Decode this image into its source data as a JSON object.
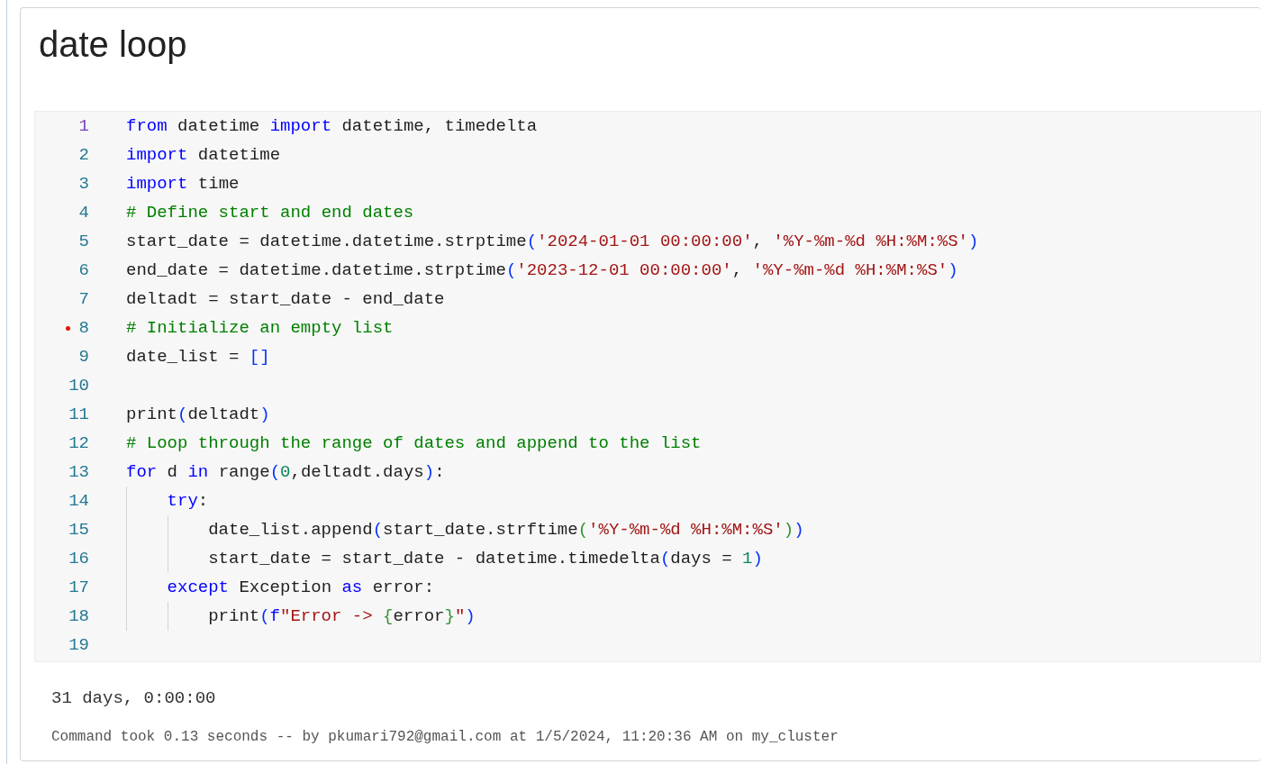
{
  "cell": {
    "title": "date loop",
    "code_lines": [
      {
        "number": "1",
        "active": true,
        "marked": false,
        "tokens": [
          {
            "kind": "kw",
            "text": "from"
          },
          {
            "kind": "name",
            "text": " datetime "
          },
          {
            "kind": "kw",
            "text": "import"
          },
          {
            "kind": "name",
            "text": " datetime, timedelta"
          }
        ]
      },
      {
        "number": "2",
        "active": false,
        "marked": false,
        "tokens": [
          {
            "kind": "kw",
            "text": "import"
          },
          {
            "kind": "name",
            "text": " datetime"
          }
        ]
      },
      {
        "number": "3",
        "active": false,
        "marked": false,
        "tokens": [
          {
            "kind": "kw",
            "text": "import"
          },
          {
            "kind": "name",
            "text": " time"
          }
        ]
      },
      {
        "number": "4",
        "active": false,
        "marked": false,
        "tokens": [
          {
            "kind": "com",
            "text": "# Define start and end dates"
          }
        ]
      },
      {
        "number": "5",
        "active": false,
        "marked": false,
        "tokens": [
          {
            "kind": "name",
            "text": "start_date = datetime.datetime.strptime"
          },
          {
            "kind": "b1",
            "text": "("
          },
          {
            "kind": "str",
            "text": "'2024-01-01 00:00:00'"
          },
          {
            "kind": "name",
            "text": ", "
          },
          {
            "kind": "str",
            "text": "'%Y-%m-%d %H:%M:%S'"
          },
          {
            "kind": "b1",
            "text": ")"
          }
        ]
      },
      {
        "number": "6",
        "active": false,
        "marked": false,
        "tokens": [
          {
            "kind": "name",
            "text": "end_date = datetime.datetime.strptime"
          },
          {
            "kind": "b1",
            "text": "("
          },
          {
            "kind": "str",
            "text": "'2023-12-01 00:00:00'"
          },
          {
            "kind": "name",
            "text": ", "
          },
          {
            "kind": "str",
            "text": "'%Y-%m-%d %H:%M:%S'"
          },
          {
            "kind": "b1",
            "text": ")"
          }
        ]
      },
      {
        "number": "7",
        "active": false,
        "marked": false,
        "tokens": [
          {
            "kind": "name",
            "text": "deltadt = start_date - end_date"
          }
        ]
      },
      {
        "number": "8",
        "active": false,
        "marked": true,
        "tokens": [
          {
            "kind": "com",
            "text": "# Initialize an empty list"
          }
        ]
      },
      {
        "number": "9",
        "active": false,
        "marked": false,
        "tokens": [
          {
            "kind": "name",
            "text": "date_list = "
          },
          {
            "kind": "b1",
            "text": "[]"
          }
        ]
      },
      {
        "number": "10",
        "active": false,
        "marked": false
      },
      {
        "number": "11",
        "active": false,
        "marked": false,
        "tokens": [
          {
            "kind": "name",
            "text": "print"
          },
          {
            "kind": "b1",
            "text": "("
          },
          {
            "kind": "name",
            "text": "deltadt"
          },
          {
            "kind": "b1",
            "text": ")"
          }
        ]
      },
      {
        "number": "12",
        "active": false,
        "marked": false,
        "tokens": [
          {
            "kind": "com",
            "text": "# Loop through the range of dates and append to the list"
          }
        ]
      },
      {
        "number": "13",
        "active": false,
        "marked": false,
        "tokens": [
          {
            "kind": "kw",
            "text": "for"
          },
          {
            "kind": "name",
            "text": " d "
          },
          {
            "kind": "kw",
            "text": "in"
          },
          {
            "kind": "name",
            "text": " range"
          },
          {
            "kind": "b1",
            "text": "("
          },
          {
            "kind": "num",
            "text": "0"
          },
          {
            "kind": "name",
            "text": ",deltadt.days"
          },
          {
            "kind": "b1",
            "text": ")"
          },
          {
            "kind": "name",
            "text": ":"
          }
        ]
      },
      {
        "number": "14",
        "active": false,
        "marked": false,
        "tokens": [
          {
            "kind": "guide"
          },
          {
            "kind": "kw",
            "text": "try"
          },
          {
            "kind": "name",
            "text": ":"
          }
        ]
      },
      {
        "number": "15",
        "active": false,
        "marked": false,
        "tokens": [
          {
            "kind": "guide"
          },
          {
            "kind": "guide"
          },
          {
            "kind": "name",
            "text": "date_list.append"
          },
          {
            "kind": "b1",
            "text": "("
          },
          {
            "kind": "name",
            "text": "start_date.strftime"
          },
          {
            "kind": "b2",
            "text": "("
          },
          {
            "kind": "str",
            "text": "'%Y-%m-%d %H:%M:%S'"
          },
          {
            "kind": "b2",
            "text": ")"
          },
          {
            "kind": "b1",
            "text": ")"
          }
        ]
      },
      {
        "number": "16",
        "active": false,
        "marked": false,
        "tokens": [
          {
            "kind": "guide"
          },
          {
            "kind": "guide"
          },
          {
            "kind": "name",
            "text": "start_date = start_date - datetime.timedelta"
          },
          {
            "kind": "b1",
            "text": "("
          },
          {
            "kind": "name",
            "text": "days = "
          },
          {
            "kind": "num",
            "text": "1"
          },
          {
            "kind": "b1",
            "text": ")"
          }
        ]
      },
      {
        "number": "17",
        "active": false,
        "marked": false,
        "tokens": [
          {
            "kind": "guide"
          },
          {
            "kind": "kw",
            "text": "except"
          },
          {
            "kind": "name",
            "text": " Exception "
          },
          {
            "kind": "kw",
            "text": "as"
          },
          {
            "kind": "name",
            "text": " error:"
          }
        ]
      },
      {
        "number": "18",
        "active": false,
        "marked": false,
        "tokens": [
          {
            "kind": "guide"
          },
          {
            "kind": "guide"
          },
          {
            "kind": "name",
            "text": "print"
          },
          {
            "kind": "b1",
            "text": "("
          },
          {
            "kind": "kw",
            "text": "f"
          },
          {
            "kind": "str",
            "text": "\"Error -> "
          },
          {
            "kind": "b2",
            "text": "{"
          },
          {
            "kind": "name",
            "text": "error"
          },
          {
            "kind": "b2",
            "text": "}"
          },
          {
            "kind": "str",
            "text": "\""
          },
          {
            "kind": "b1",
            "text": ")"
          }
        ]
      },
      {
        "number": "19",
        "active": false,
        "marked": false
      }
    ],
    "output": "31 days, 0:00:00",
    "command_info": "Command took 0.13 seconds -- by pkumari792@gmail.com at 1/5/2024, 11:20:36 AM on my_cluster"
  }
}
